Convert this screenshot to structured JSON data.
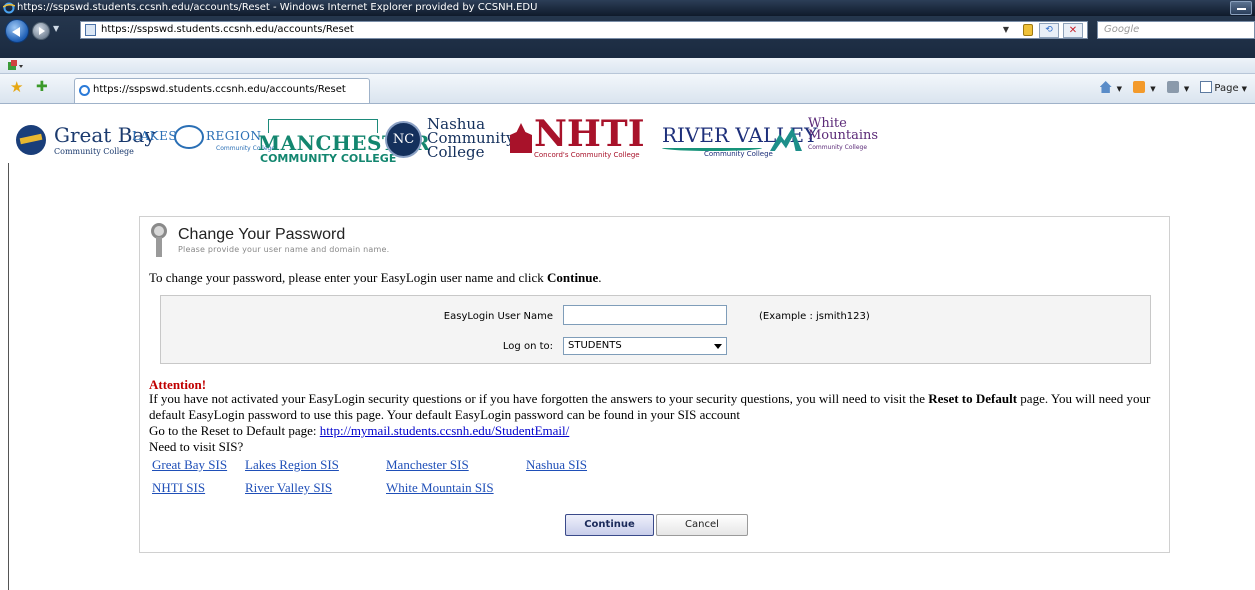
{
  "window": {
    "title": "https://sspswd.students.ccsnh.edu/accounts/Reset - Windows Internet Explorer provided by CCSNH.EDU"
  },
  "address_bar": {
    "url": "https://sspswd.students.ccsnh.edu/accounts/Reset",
    "search_placeholder": "Google"
  },
  "tab": {
    "label": "https://sspswd.students.ccsnh.edu/accounts/Reset"
  },
  "command_bar": {
    "page_label": "Page"
  },
  "logos": {
    "great_bay": {
      "name": "Great Bay",
      "sub": "Community College"
    },
    "lakes_region": {
      "part1": "LAKES",
      "part2": "REGION",
      "sub": "Community College"
    },
    "manchester": {
      "name": "MANCHESTER",
      "sub": "COMMUNITY COLLEGE"
    },
    "nashua": {
      "seal": "NC",
      "line1": "Nashua",
      "line2": "Community",
      "line3": "College"
    },
    "nhti": {
      "name": "NHTI",
      "sub": "Concord's Community College"
    },
    "river_valley": {
      "name": "RIVER VALLEY",
      "sub": "Community College"
    },
    "white_mountains": {
      "line1": "White",
      "line2": "Mountains",
      "sub": "Community College"
    }
  },
  "panel": {
    "title": "Change Your Password",
    "subtitle": "Please provide your user name and domain name.",
    "instructions_prefix": "To change your password, please enter your EasyLogin user name and click ",
    "instructions_bold": "Continue",
    "instructions_suffix": "."
  },
  "form": {
    "username_label": "EasyLogin User Name",
    "username_value": "",
    "example": "(Example : jsmith123)",
    "logon_label": "Log on to:",
    "logon_value": "STUDENTS"
  },
  "attention": {
    "heading": "Attention!",
    "body_prefix": "If you have not activated your EasyLogin security questions or if you have forgotten the answers to your security questions, you will need to visit the ",
    "body_bold": "Reset to Default",
    "body_suffix": " page. You will need your default EasyLogin password to use this page. Your default EasyLogin password can be found in your SIS account",
    "goto_label": "Go to the Reset to Default page: ",
    "goto_link": "http://mymail.students.ccsnh.edu/StudentEmail/",
    "need_sis": "Need to visit SIS?"
  },
  "sis_links": [
    "Great Bay SIS",
    "Lakes Region SIS",
    "Manchester SIS",
    "Nashua SIS",
    "NHTI SIS",
    "River Valley SIS",
    "White Mountain SIS"
  ],
  "buttons": {
    "continue": "Continue",
    "cancel": "Cancel"
  },
  "colors": {
    "attention": "#c00000",
    "link": "#1f4fb8",
    "nhti_red": "#a8122a",
    "manchester_green": "#13866f"
  }
}
